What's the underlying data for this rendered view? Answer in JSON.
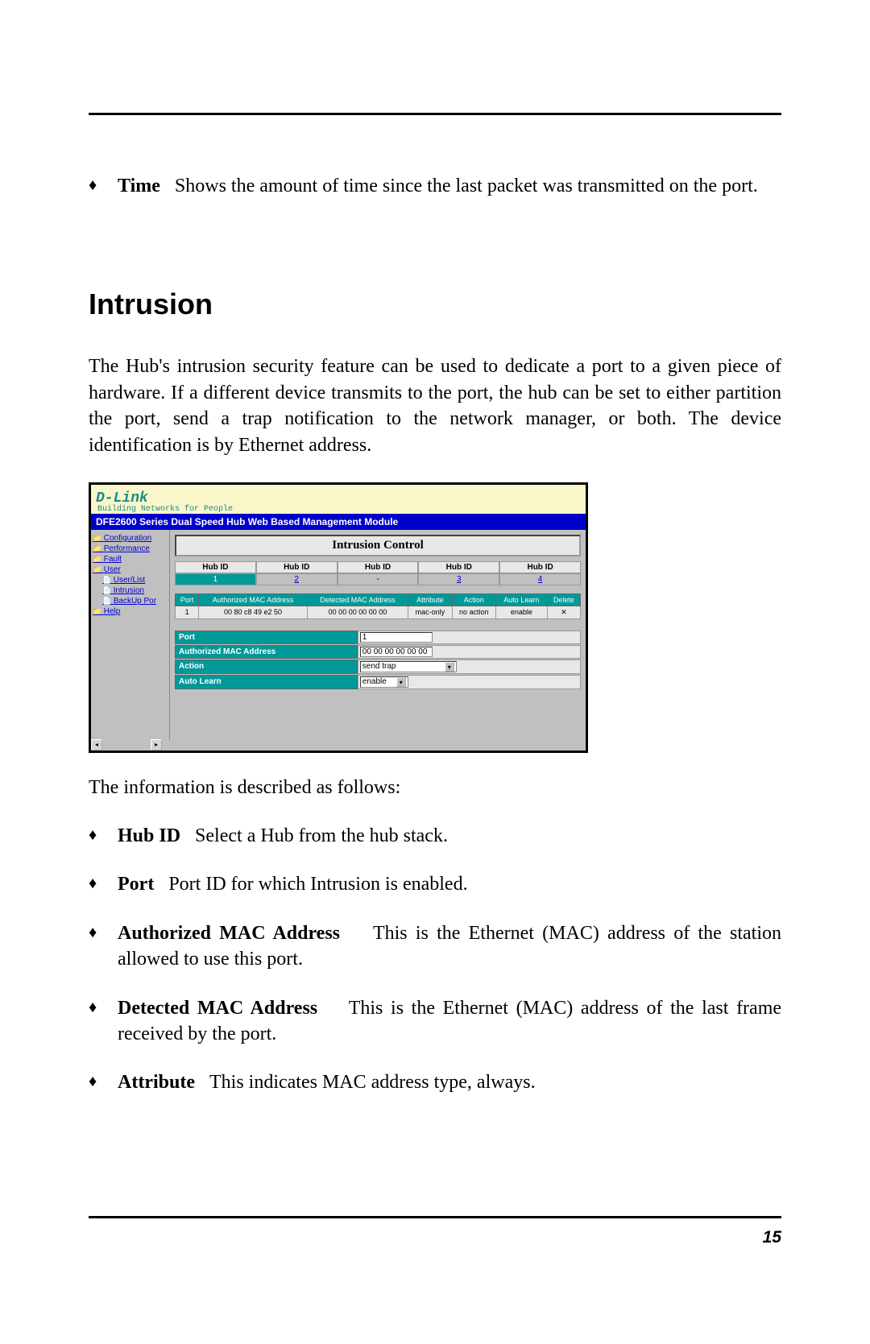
{
  "page_number": "15",
  "bullet_time": {
    "label": "Time",
    "text": "Shows the amount of time since the last packet was transmitted on the port."
  },
  "heading": "Intrusion",
  "intro_para": "The Hub's intrusion security feature can be used to dedicate a port to a given piece of hardware.  If a different device transmits to the port, the hub can be set to either partition the port, send a trap notification to the network manager, or both.   The device identification is by Ethernet address.",
  "list_intro": "The information is described as follows:",
  "bullets": [
    {
      "label": "Hub ID",
      "text": "Select a Hub from the hub stack."
    },
    {
      "label": "Port",
      "text": "Port ID for which Intrusion is enabled."
    },
    {
      "label": "Authorized MAC Address",
      "text": "This is the Ethernet (MAC) address of the station allowed to use this port."
    },
    {
      "label": "Detected MAC Address",
      "text": "This is the Ethernet (MAC) address of the last frame received by the port."
    },
    {
      "label": "Attribute",
      "text": "This indicates MAC address type, always."
    }
  ],
  "screenshot": {
    "logo": "D-Link",
    "tagline": "Building Networks for People",
    "bluebar": "DFE2600 Series Dual Speed Hub Web Based Management Module",
    "sidebar": {
      "items": [
        {
          "type": "folder",
          "label": "Configuration"
        },
        {
          "type": "folder",
          "label": "Performance"
        },
        {
          "type": "folder",
          "label": "Fault"
        },
        {
          "type": "folder",
          "label": "User"
        },
        {
          "type": "file",
          "label": "User/List"
        },
        {
          "type": "file",
          "label": "Intrusion"
        },
        {
          "type": "file",
          "label": "BackUp Por"
        },
        {
          "type": "folder",
          "label": "Help"
        }
      ]
    },
    "panel_title": "Intrusion Control",
    "hub_header": "Hub ID",
    "hubs": [
      "1",
      "2",
      "-",
      "3",
      "4"
    ],
    "table": {
      "headers": [
        "Port",
        "Authorized MAC Address",
        "Detected MAC Address",
        "Attribute",
        "Action",
        "Auto Learn",
        "Delete"
      ],
      "row": [
        "1",
        "00 80 c8 49 e2 50",
        "00 00 00 00 00 00",
        "mac-only",
        "no action",
        "enable",
        "✕"
      ]
    },
    "form": {
      "port": {
        "label": "Port",
        "value": "1"
      },
      "auth_mac": {
        "label": "Authorized MAC Address",
        "value": "00 00 00 00 00 00"
      },
      "action": {
        "label": "Action",
        "value": "send trap"
      },
      "auto_learn": {
        "label": "Auto Learn",
        "value": "enable"
      }
    }
  }
}
